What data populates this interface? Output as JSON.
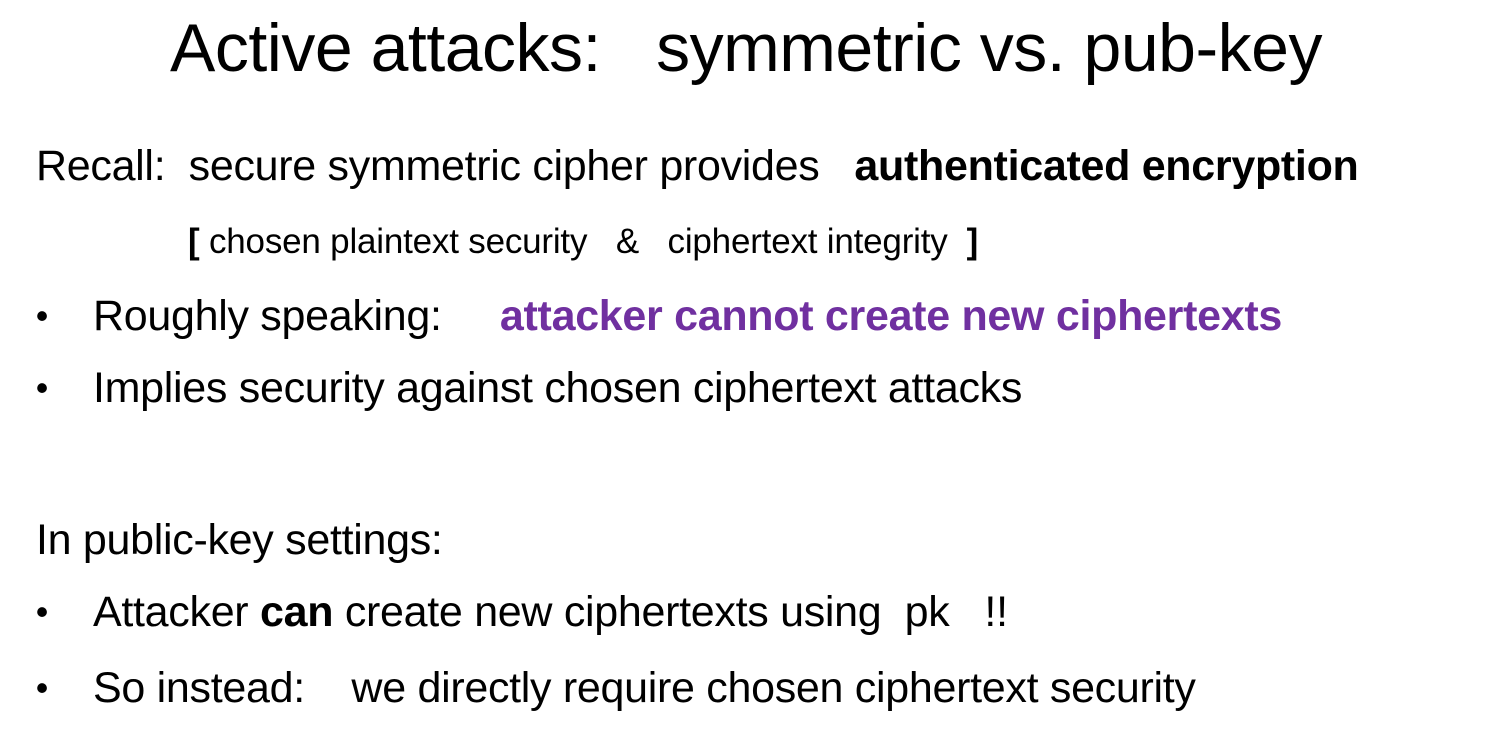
{
  "title": "Active attacks:   symmetric vs. pub-key",
  "recall": {
    "lead": "Recall:  secure symmetric cipher provides   ",
    "emphasis": "authenticated encryption"
  },
  "bracket_line": {
    "open": "[",
    "text": " chosen plaintext security   &   ciphertext integrity  ",
    "close": "]"
  },
  "bullets_1": [
    {
      "marker": "•",
      "lead": "Roughly speaking:     ",
      "emphasis": "attacker cannot create new ciphertexts"
    },
    {
      "marker": "•",
      "text": "Implies security against chosen ciphertext attacks"
    }
  ],
  "pk_heading": "In public-key settings:",
  "bullets_2": [
    {
      "marker": "•",
      "pre": "Attacker ",
      "bold": "can",
      "post": " create new ciphertexts using  pk   !!"
    },
    {
      "marker": "•",
      "text": "So instead:    we directly require chosen ciphertext security"
    }
  ],
  "colors": {
    "accent": "#7030a0",
    "text": "#000000",
    "background": "#ffffff"
  }
}
